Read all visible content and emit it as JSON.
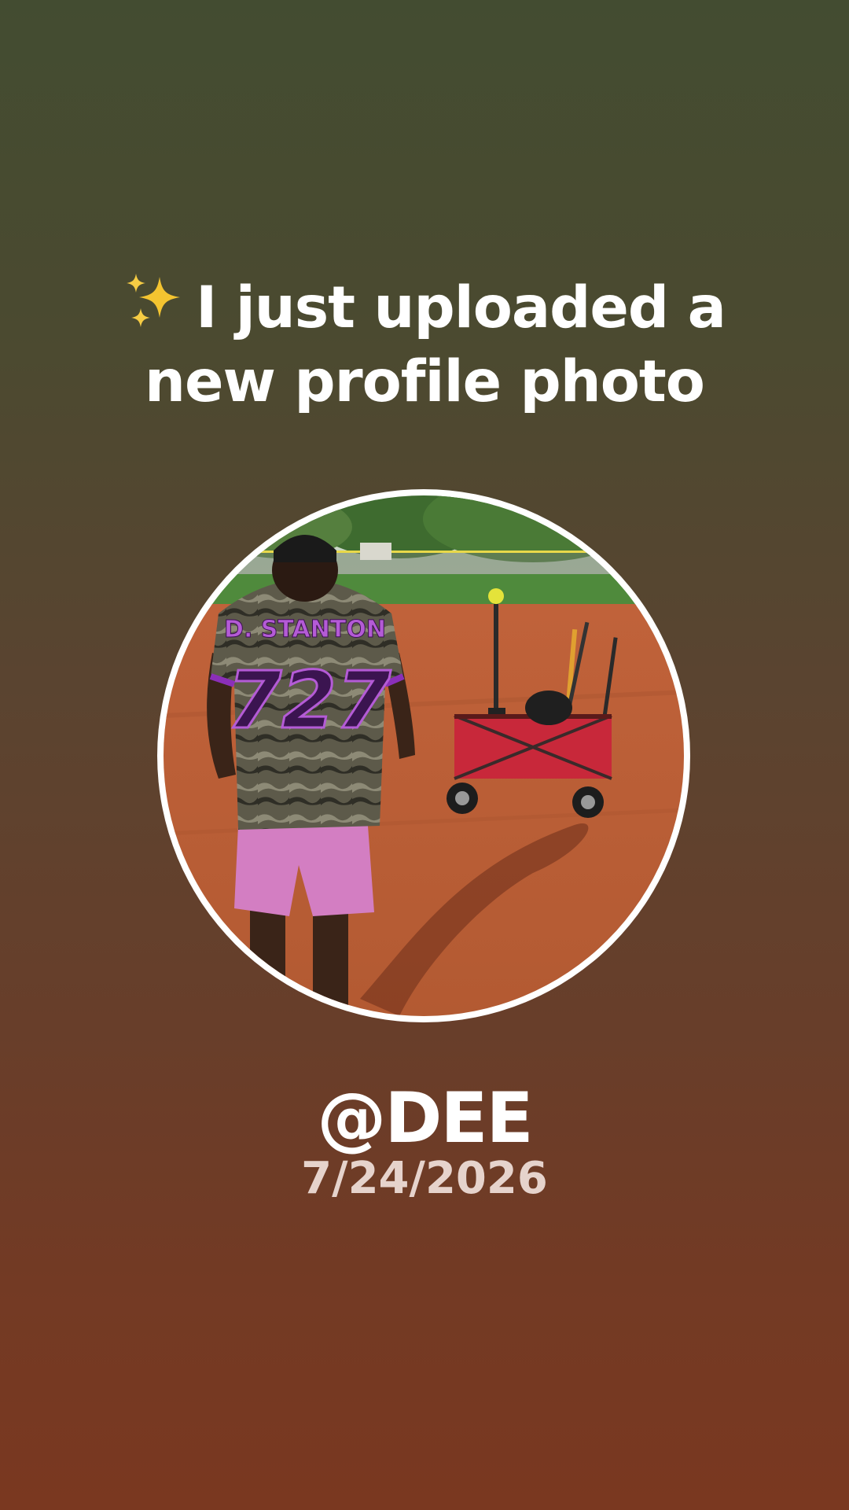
{
  "story": {
    "headline_line1": "I just uploaded a",
    "headline_line2": "new profile photo",
    "sparkle_icon": "sparkles-icon",
    "username": "@DEE",
    "date": "7/24/2026",
    "photo": {
      "jersey_name": "D. STANTON",
      "jersey_number": "727"
    }
  },
  "colors": {
    "background_top": "#434c31",
    "background_bottom": "#7a3820",
    "text": "#ffffff",
    "date_text": "#e6d3cc",
    "ring": "#ffffff"
  }
}
